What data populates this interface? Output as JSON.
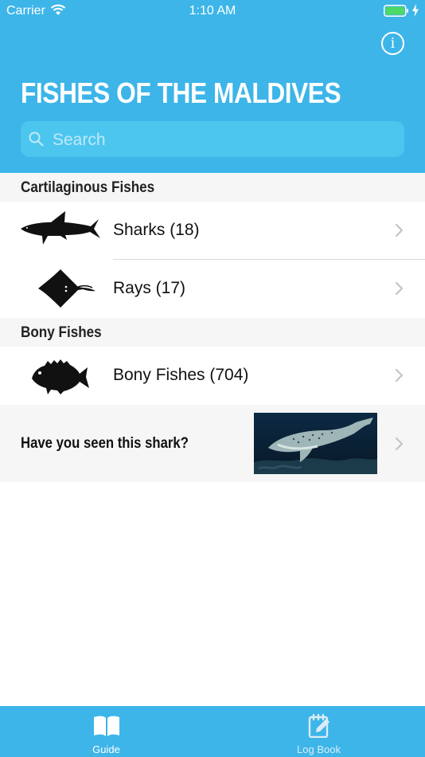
{
  "status_bar": {
    "carrier": "Carrier",
    "time": "1:10 AM"
  },
  "header": {
    "title": "FISHES OF THE MALDIVES",
    "info_icon": "info-icon"
  },
  "search": {
    "placeholder": "Search"
  },
  "sections": [
    {
      "title": "Cartilaginous Fishes",
      "rows": [
        {
          "label": "Sharks (18)",
          "icon": "shark-icon"
        },
        {
          "label": "Rays (17)",
          "icon": "ray-icon"
        }
      ]
    },
    {
      "title": "Bony Fishes",
      "rows": [
        {
          "label": "Bony Fishes (704)",
          "icon": "bony-fish-icon"
        }
      ]
    }
  ],
  "promo": {
    "text": "Have you seen this shark?"
  },
  "tab_bar": {
    "tabs": [
      {
        "label": "Guide",
        "icon": "book-icon",
        "selected": true
      },
      {
        "label": "Log Book",
        "icon": "logbook-edit-icon",
        "selected": false
      }
    ]
  },
  "colors": {
    "header": "#3db5e8",
    "search_field": "#4cc6ef",
    "section_bg": "#f6f6f6",
    "battery": "#4cd964"
  }
}
